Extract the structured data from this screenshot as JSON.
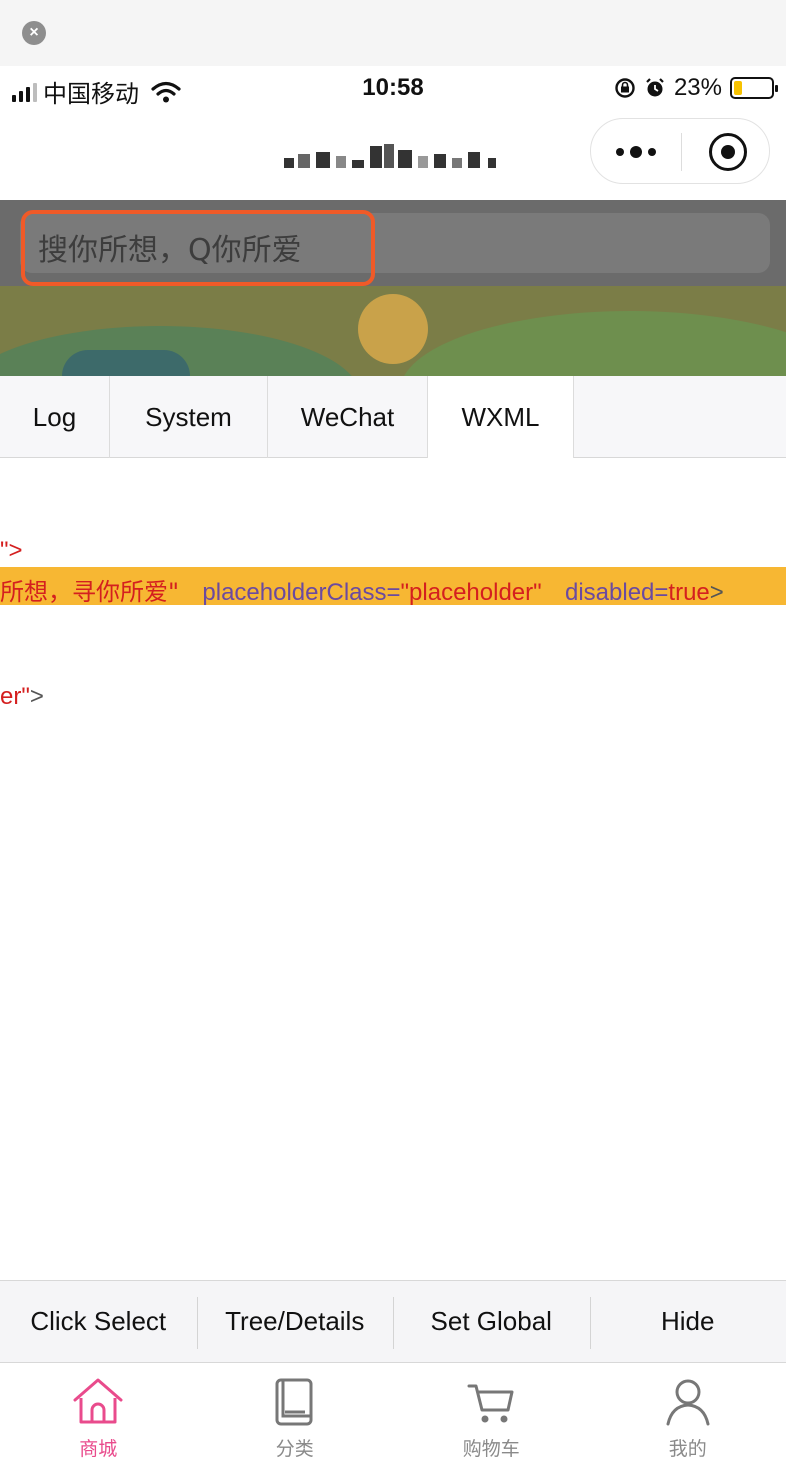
{
  "status_bar": {
    "carrier": "中国移动",
    "time": "10:58",
    "battery": "23%",
    "battery_level": 0.23
  },
  "search": {
    "placeholder": "搜你所想，Q你所爱"
  },
  "debugger": {
    "tabs": [
      {
        "label": "Log",
        "active": false
      },
      {
        "label": "System",
        "active": false
      },
      {
        "label": "WeChat",
        "active": false
      },
      {
        "label": "WXML",
        "active": true
      }
    ],
    "code": {
      "line1": "\">",
      "line2_value": "所想，寻你所爱\"",
      "line2_attr1": "placeholderClass=",
      "line2_attr1_value": "\"placeholder\"",
      "line2_attr2": "disabled=",
      "line2_attr2_value": "true",
      "line2_end": ">",
      "line3_value": "er\"",
      "line3_end": ">"
    }
  },
  "toolbar": {
    "click_select": "Click Select",
    "tree_details": "Tree/Details",
    "set_global": "Set Global",
    "hide": "Hide"
  },
  "tabbar": {
    "items": [
      {
        "label": "商城",
        "icon": "home-icon",
        "active": true
      },
      {
        "label": "分类",
        "icon": "category-book-icon",
        "active": false
      },
      {
        "label": "购物车",
        "icon": "cart-icon",
        "active": false
      },
      {
        "label": "我的",
        "icon": "profile-icon",
        "active": false
      }
    ]
  },
  "colors": {
    "accent": "#e94b8c",
    "highlight_outline": "#f05a28",
    "code_highlight": "#f7b733"
  }
}
